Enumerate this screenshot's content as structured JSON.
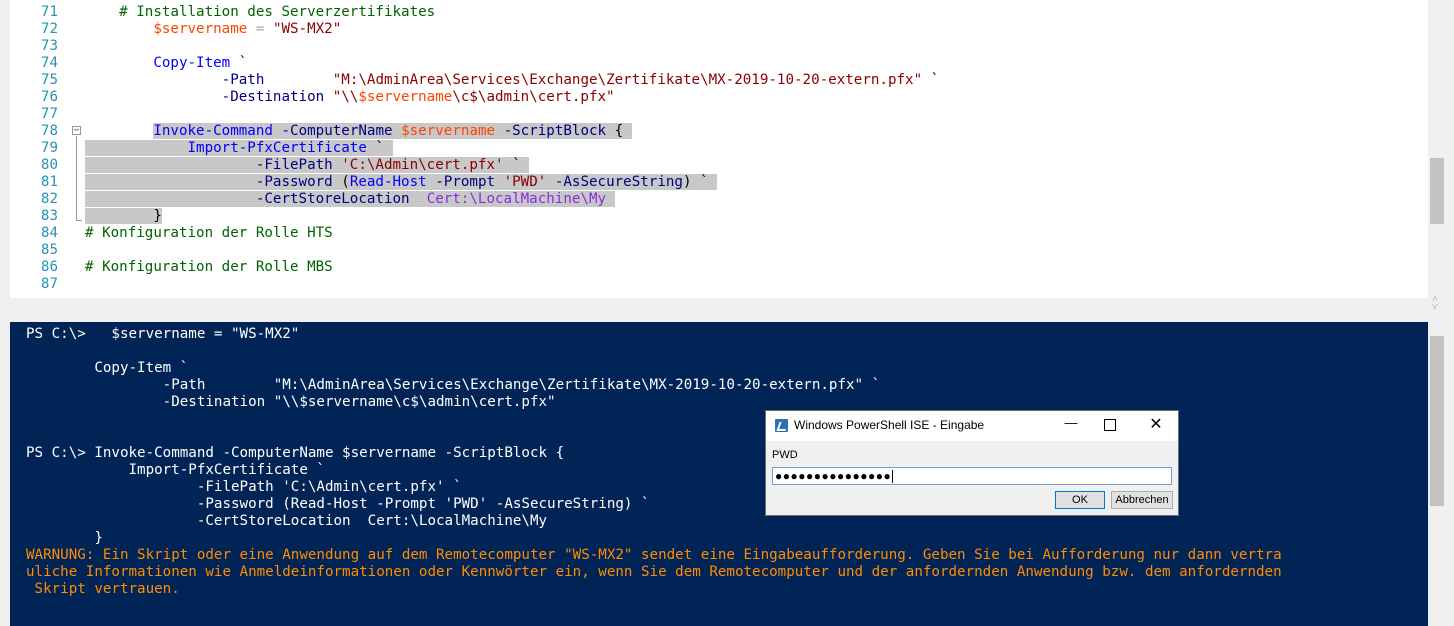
{
  "editor": {
    "lines": [
      {
        "num": "71",
        "segs": [
          {
            "t": "    # Installation des Serverzertifikates",
            "c": "c-comment"
          }
        ]
      },
      {
        "num": "72",
        "segs": [
          {
            "t": "        "
          },
          {
            "t": "$servername",
            "c": "c-var"
          },
          {
            "t": " = ",
            "c": "c-op"
          },
          {
            "t": "\"WS-MX2\"",
            "c": "c-str"
          }
        ]
      },
      {
        "num": "73",
        "segs": []
      },
      {
        "num": "74",
        "segs": [
          {
            "t": "        "
          },
          {
            "t": "Copy-Item",
            "c": "c-cmd"
          },
          {
            "t": " `"
          }
        ]
      },
      {
        "num": "75",
        "segs": [
          {
            "t": "                "
          },
          {
            "t": "-Path",
            "c": "c-param"
          },
          {
            "t": "        "
          },
          {
            "t": "\"M:\\AdminArea\\Services\\Exchange\\Zertifikate\\MX-2019-10-20-extern.pfx\"",
            "c": "c-str"
          },
          {
            "t": " `"
          }
        ]
      },
      {
        "num": "76",
        "segs": [
          {
            "t": "                "
          },
          {
            "t": "-Destination",
            "c": "c-param"
          },
          {
            "t": " "
          },
          {
            "t": "\"\\\\",
            "c": "c-str"
          },
          {
            "t": "$servername",
            "c": "c-var"
          },
          {
            "t": "\\c$\\admin\\cert.pfx\"",
            "c": "c-str"
          }
        ]
      },
      {
        "num": "77",
        "segs": []
      },
      {
        "num": "78",
        "segs": [
          {
            "t": "        "
          },
          {
            "t": "Invoke-Command",
            "c": "c-cmd",
            "sel": true
          },
          {
            "t": " ",
            "sel": true
          },
          {
            "t": "-ComputerName",
            "c": "c-param",
            "sel": true
          },
          {
            "t": " ",
            "sel": true
          },
          {
            "t": "$servername",
            "c": "c-var",
            "sel": true
          },
          {
            "t": " ",
            "sel": true
          },
          {
            "t": "-ScriptBlock",
            "c": "c-param",
            "sel": true
          },
          {
            "t": " { ",
            "sel": true
          }
        ]
      },
      {
        "num": "79",
        "segs": [
          {
            "t": "            ",
            "sel": true
          },
          {
            "t": "Import-PfxCertificate",
            "c": "c-cmd",
            "sel": true
          },
          {
            "t": " ` ",
            "sel": true
          }
        ]
      },
      {
        "num": "80",
        "segs": [
          {
            "t": "                    ",
            "sel": true
          },
          {
            "t": "-FilePath",
            "c": "c-param",
            "sel": true
          },
          {
            "t": " ",
            "sel": true
          },
          {
            "t": "'C:\\Admin\\cert.pfx'",
            "c": "c-str",
            "sel": true
          },
          {
            "t": " ` ",
            "sel": true
          }
        ]
      },
      {
        "num": "81",
        "segs": [
          {
            "t": "                    ",
            "sel": true
          },
          {
            "t": "-Password",
            "c": "c-param",
            "sel": true
          },
          {
            "t": " (",
            "sel": true
          },
          {
            "t": "Read-Host",
            "c": "c-cmd",
            "sel": true
          },
          {
            "t": " ",
            "sel": true
          },
          {
            "t": "-Prompt",
            "c": "c-param",
            "sel": true
          },
          {
            "t": " ",
            "sel": true
          },
          {
            "t": "'PWD'",
            "c": "c-str",
            "sel": true
          },
          {
            "t": " ",
            "sel": true
          },
          {
            "t": "-AsSecureString",
            "c": "c-param",
            "sel": true
          },
          {
            "t": ") ` ",
            "sel": true
          }
        ]
      },
      {
        "num": "82",
        "segs": [
          {
            "t": "                    ",
            "sel": true
          },
          {
            "t": "-CertStoreLocation",
            "c": "c-param",
            "sel": true
          },
          {
            "t": "  ",
            "sel": true
          },
          {
            "t": "Cert:\\LocalMachine\\My",
            "c": "c-path",
            "sel": true
          },
          {
            "t": " ",
            "sel": true
          }
        ]
      },
      {
        "num": "83",
        "segs": [
          {
            "t": "        }",
            "sel": true
          }
        ]
      },
      {
        "num": "84",
        "segs": [
          {
            "t": "# Konfiguration der Rolle HTS",
            "c": "c-comment"
          }
        ]
      },
      {
        "num": "85",
        "segs": []
      },
      {
        "num": "86",
        "segs": [
          {
            "t": "# Konfiguration der Rolle MBS",
            "c": "c-comment"
          }
        ]
      },
      {
        "num": "87",
        "segs": []
      }
    ]
  },
  "console": {
    "lines": [
      {
        "t": "PS C:\\>   $servername = \"WS-MX2\""
      },
      {
        "t": ""
      },
      {
        "t": "        Copy-Item `"
      },
      {
        "t": "                -Path        \"M:\\AdminArea\\Services\\Exchange\\Zertifikate\\MX-2019-10-20-extern.pfx\" `"
      },
      {
        "t": "                -Destination \"\\\\$servername\\c$\\admin\\cert.pfx\""
      },
      {
        "t": ""
      },
      {
        "t": ""
      },
      {
        "t": "PS C:\\> Invoke-Command -ComputerName $servername -ScriptBlock {"
      },
      {
        "t": "            Import-PfxCertificate `"
      },
      {
        "t": "                    -FilePath 'C:\\Admin\\cert.pfx' `"
      },
      {
        "t": "                    -Password (Read-Host -Prompt 'PWD' -AsSecureString) `"
      },
      {
        "t": "                    -CertStoreLocation  Cert:\\LocalMachine\\My"
      },
      {
        "t": "        }"
      },
      {
        "t": "WARNUNG: Ein Skript oder eine Anwendung auf dem Remotecomputer \"WS-MX2\" sendet eine Eingabeaufforderung. Geben Sie bei Aufforderung nur dann vertra",
        "warn": true
      },
      {
        "t": "uliche Informationen wie Anmeldeinformationen oder Kennwörter ein, wenn Sie dem Remotecomputer und der anfordernden Anwendung bzw. dem anfordernden",
        "warn": true
      },
      {
        "t": " Skript vertrauen.",
        "warn": true
      }
    ]
  },
  "dialog": {
    "title": "Windows PowerShell ISE - Eingabe",
    "minimize_glyph": "—",
    "close_glyph": "✕",
    "label": "PWD",
    "input_value": "●●●●●●●●●●●●●●●",
    "ok_label": "OK",
    "cancel_label": "Abbrechen"
  },
  "scroll_glyphs": {
    "up": "˄",
    "down": "˅"
  },
  "colors": {
    "console_bg": "#012456",
    "warning": "#ff8c00",
    "selection": "#c8c8c8",
    "line_numbers": "#2b91af"
  }
}
